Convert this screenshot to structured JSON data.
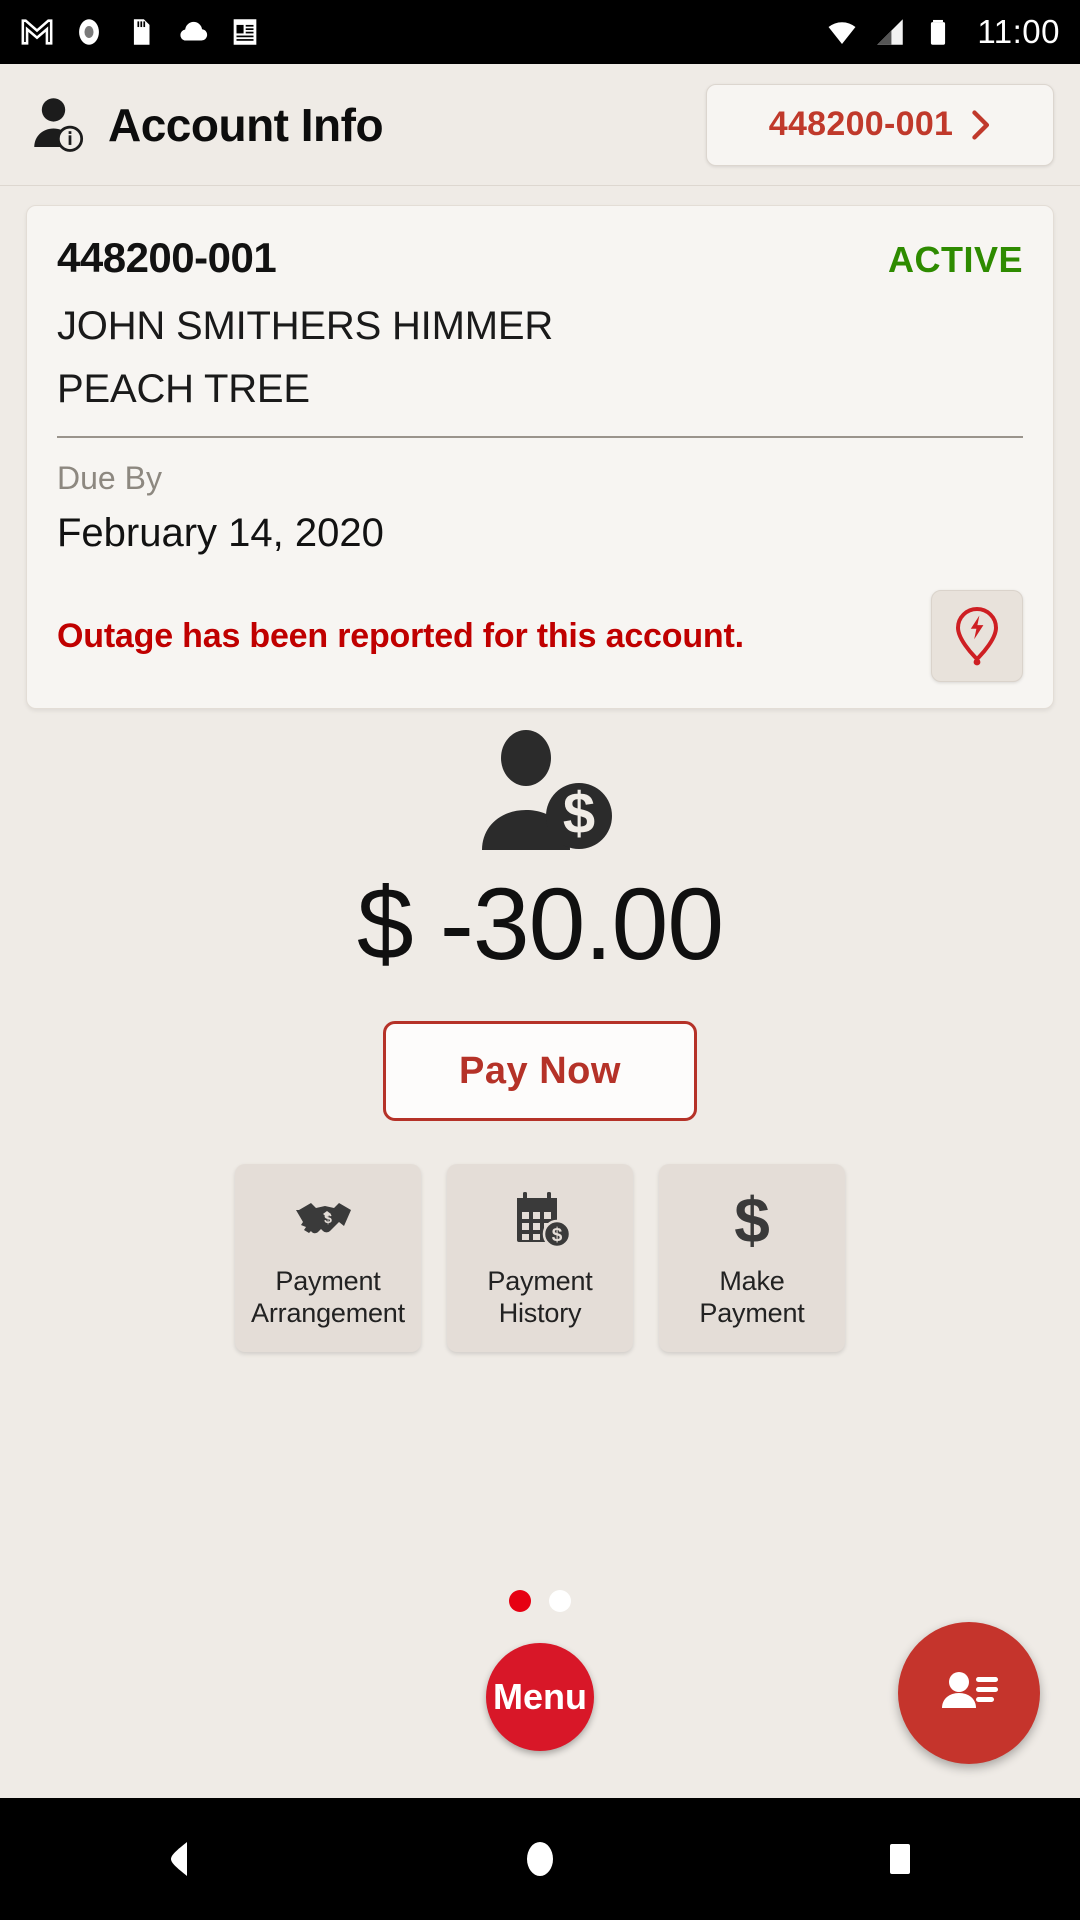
{
  "statusbar": {
    "time": "11:00",
    "left_icons": [
      {
        "name": "gmail-icon",
        "label": "M"
      },
      {
        "name": "record-icon",
        "label": "record"
      },
      {
        "name": "sdcard-icon",
        "label": "sd card"
      },
      {
        "name": "cloud-icon",
        "label": "cloud"
      },
      {
        "name": "notes-icon",
        "label": "notes"
      }
    ],
    "right_icons": [
      {
        "name": "wifi-icon",
        "label": "wifi"
      },
      {
        "name": "signal-icon",
        "label": "signal"
      },
      {
        "name": "battery-icon",
        "label": "battery"
      }
    ]
  },
  "header": {
    "title": "Account Info",
    "account_chip": "448200-001",
    "icon": "account-info-icon",
    "chevron": "chevron-right-icon"
  },
  "account_card": {
    "account_number": "448200-001",
    "status": "ACTIVE",
    "status_color": "#2E8B00",
    "customer_name": "JOHN SMITHERS HIMMER",
    "address": "PEACH TREE",
    "due_label": "Due By",
    "due_date": "February 14, 2020",
    "outage_message": "Outage has been reported for this account.",
    "outage_color": "#C00000",
    "outage_icon": "outage-pin-icon"
  },
  "balance": {
    "icon": "person-money-icon",
    "amount": "$ -30.00",
    "pay_now_label": "Pay Now",
    "accent_color": "#B53228"
  },
  "tiles": [
    {
      "icon": "handshake-icon",
      "line1": "Payment",
      "line2": "Arrangement",
      "name": "payment-arrangement"
    },
    {
      "icon": "calendar-money-icon",
      "line1": "Payment",
      "line2": "History",
      "name": "payment-history"
    },
    {
      "icon": "dollar-sign-icon",
      "line1": "Make",
      "line2": "Payment",
      "name": "make-payment"
    }
  ],
  "pager": {
    "total": 2,
    "active_index": 0,
    "active_color": "#E60012",
    "inactive_color": "#FFFFFF"
  },
  "bottom": {
    "menu_label": "Menu",
    "menu_color": "#D81728",
    "contact_icon": "contact-card-icon",
    "contact_color": "#C5342C"
  },
  "navbar": {
    "back": "back-triangle-icon",
    "home": "home-circle-icon",
    "recents": "recents-square-icon"
  }
}
